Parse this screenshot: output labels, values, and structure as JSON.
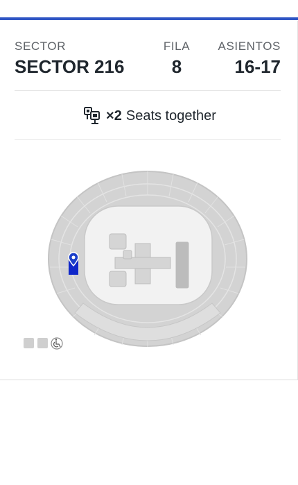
{
  "colors": {
    "accent": "#2f55c4",
    "selected_seat": "#0f27c9",
    "venue_section": "#d3d3d3",
    "venue_outline": "#c4c4c4"
  },
  "ticket": {
    "sector_label": "SECTOR",
    "sector_value": "SECTOR 216",
    "row_label": "FILA",
    "row_value": "8",
    "seats_label": "ASIENTOS",
    "seats_value": "16-17"
  },
  "seating": {
    "icon": "seats-together-icon",
    "quantity": "×2",
    "label": "Seats together"
  },
  "map": {
    "icon": "location-pin-icon",
    "legend": [
      {
        "name": "seat-legend-standard",
        "icon": "square"
      },
      {
        "name": "seat-legend-standard-2",
        "icon": "square"
      },
      {
        "name": "wheelchair-icon",
        "icon": "wheelchair"
      }
    ]
  }
}
